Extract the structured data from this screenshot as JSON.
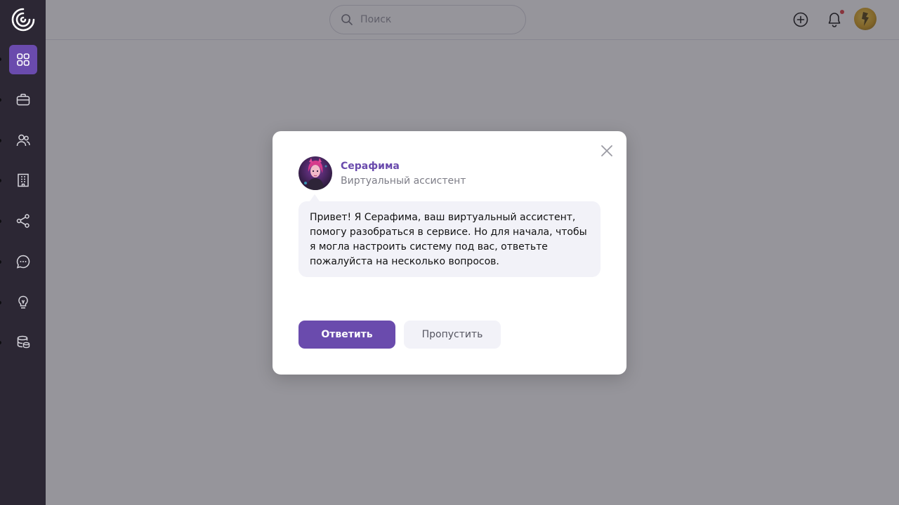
{
  "search": {
    "placeholder": "Поиск"
  },
  "sidebar": {
    "items": [
      {
        "icon": "dashboard-grid-icon",
        "active": true
      },
      {
        "icon": "briefcase-icon",
        "active": false
      },
      {
        "icon": "users-icon",
        "active": false
      },
      {
        "icon": "building-icon",
        "active": false
      },
      {
        "icon": "share-icon",
        "active": false
      },
      {
        "icon": "chat-icon",
        "active": false
      },
      {
        "icon": "lightbulb-icon",
        "active": false
      },
      {
        "icon": "database-icon",
        "active": false
      }
    ]
  },
  "header": {
    "icons": [
      "add-circle-icon",
      "bell-icon",
      "user-avatar"
    ]
  },
  "modal": {
    "assistant_name": "Серафима",
    "assistant_role": "Виртуальный ассистент",
    "message": "Привет! Я Серафима, ваш виртуальный ассистент, помогу разобраться в сервисе. Но для начала, чтобы я могла настроить систему под вас, ответьте пожалуйста на несколько вопросов.",
    "reply_label": "Ответить",
    "skip_label": "Пропустить"
  },
  "colors": {
    "accent": "#6a4bad",
    "sidebar_bg": "#2c2734",
    "notification_dot": "#e5484d",
    "bubble_bg": "#f2f2f8"
  }
}
